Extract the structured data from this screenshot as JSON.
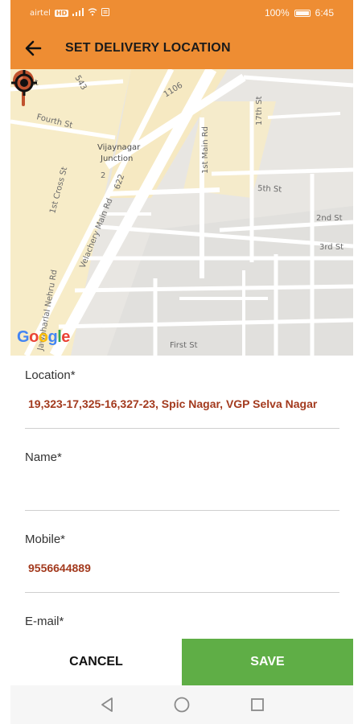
{
  "status_bar": {
    "carrier": "airtel",
    "network_badge": "HD",
    "battery_percent": "100%",
    "time": "6:45"
  },
  "app_bar": {
    "title": "SET DELIVERY LOCATION",
    "back_icon": "arrow-left-icon"
  },
  "map": {
    "streets": {
      "s1st_st": "1st St",
      "s543": "543",
      "s1106": "1106",
      "s17th": "17th St",
      "fourth": "Fourth St",
      "junction_line1": "Vijaynagar",
      "junction_line2": "Junction",
      "first_main": "1st Main Rd",
      "first_cross": "1st Cross St",
      "num2": "2",
      "num622": "622",
      "fifth": "5th St",
      "velachery": "Velachery Main Rd",
      "second": "2nd St",
      "third": "3rd St",
      "nehru": "Jawaharlal Nehru Rd",
      "first_st": "First St"
    },
    "attribution": [
      "G",
      "o",
      "o",
      "g",
      "l",
      "e"
    ],
    "attribution_colors": [
      "#4285F4",
      "#EA4335",
      "#FBBC05",
      "#4285F4",
      "#34A853",
      "#EA4335"
    ],
    "pin_icon": "map-pin-icon",
    "locate_icon": "my-location-icon"
  },
  "form": {
    "location": {
      "label": "Location*",
      "value": "19,323-17,325-16,327-23, Spic Nagar, VGP Selva Nagar"
    },
    "name": {
      "label": "Name*",
      "value": ""
    },
    "mobile": {
      "label": "Mobile*",
      "value": "9556644889"
    },
    "email": {
      "label": "E-mail*",
      "value": ""
    }
  },
  "actions": {
    "cancel_label": "CANCEL",
    "save_label": "SAVE"
  },
  "colors": {
    "app_bar": "#ee8d33",
    "save_button": "#5fae46",
    "field_value": "#a33a1e",
    "pin": "#c0522e"
  },
  "nav_bar": {
    "back_icon": "triangle-back-icon",
    "home_icon": "circle-home-icon",
    "recents_icon": "square-recents-icon"
  }
}
